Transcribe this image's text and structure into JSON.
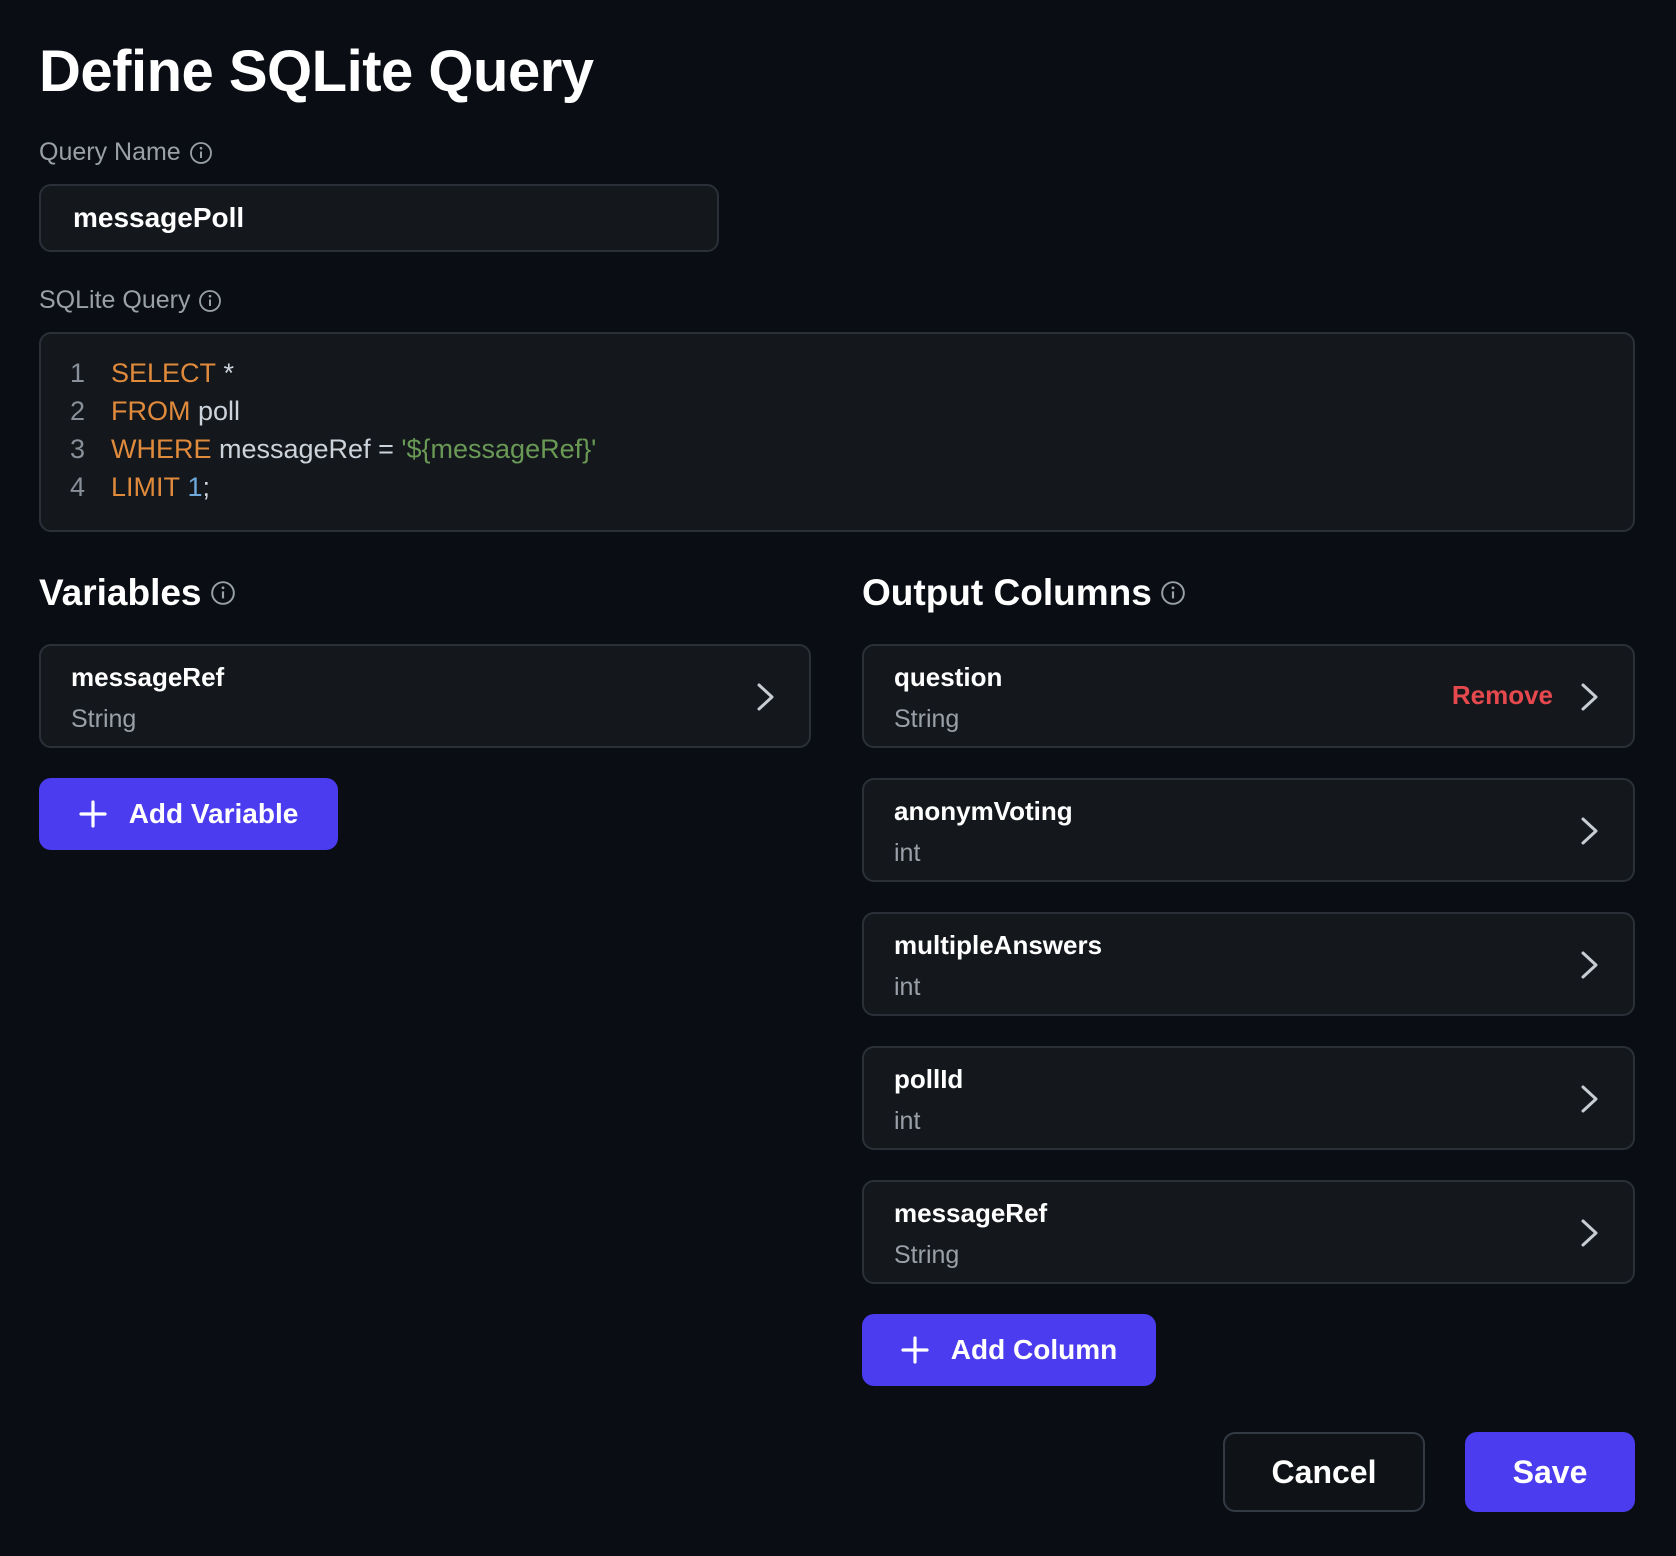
{
  "title": "Define SQLite Query",
  "query_name": {
    "label": "Query Name",
    "value": "messagePoll",
    "info_icon": "info-icon"
  },
  "sqlite_query": {
    "label": "SQLite Query",
    "info_icon": "info-icon",
    "lines": [
      {
        "number": "1",
        "keyword": "SELECT",
        "rest": " *"
      },
      {
        "number": "2",
        "keyword": "FROM",
        "rest": " poll"
      },
      {
        "number": "3",
        "keyword": "WHERE",
        "rest": " messageRef = ",
        "string": "'${messageRef}'"
      },
      {
        "number": "4",
        "keyword": "LIMIT",
        "number_value": " 1",
        "rest": ";"
      }
    ]
  },
  "variables": {
    "title": "Variables",
    "info_icon": "info-icon",
    "items": [
      {
        "name": "messageRef",
        "type": "String"
      }
    ],
    "add_label": "Add Variable"
  },
  "output_columns": {
    "title": "Output Columns",
    "info_icon": "info-icon",
    "items": [
      {
        "name": "question",
        "type": "String",
        "remove_label": "Remove"
      },
      {
        "name": "anonymVoting",
        "type": "int"
      },
      {
        "name": "multipleAnswers",
        "type": "int"
      },
      {
        "name": "pollId",
        "type": "int"
      },
      {
        "name": "messageRef",
        "type": "String"
      }
    ],
    "add_label": "Add Column"
  },
  "footer": {
    "cancel_label": "Cancel",
    "save_label": "Save"
  },
  "colors": {
    "background": "#0a0e14",
    "accent": "#4b3cf0",
    "danger": "#e5484d",
    "keyword": "#e08a3c",
    "string": "#6a9955",
    "number": "#6fa8dc"
  }
}
